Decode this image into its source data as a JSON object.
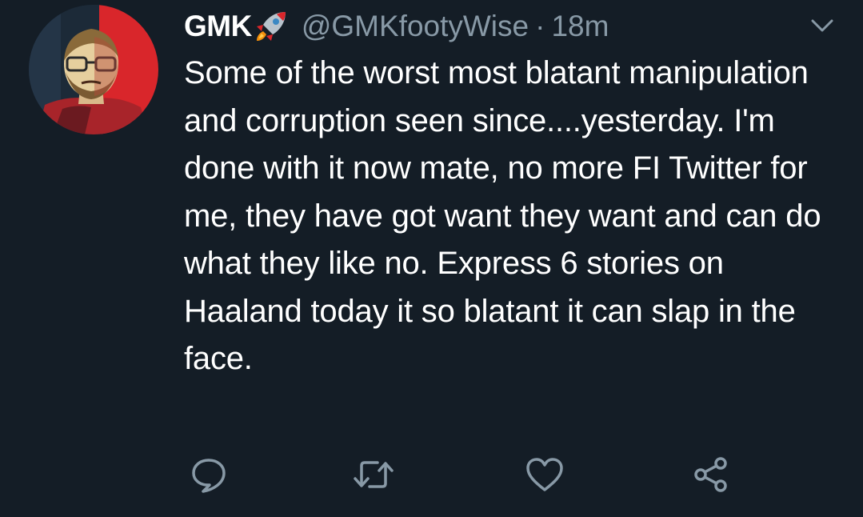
{
  "tweet": {
    "display_name": "GMK",
    "name_emoji_icon": "rocket-icon",
    "handle": "@GMKfootyWise",
    "separator": "·",
    "time": "18m",
    "text": "Some of the worst most blatant manipulation and corruption seen since....yesterday. I'm done with it now mate, no more FI Twitter for me, they have got want they want and can do what they like no. Express 6 stories on Haaland today it so blatant it can slap in the face."
  },
  "actions": [
    {
      "icon": "reply-icon"
    },
    {
      "icon": "retweet-icon"
    },
    {
      "icon": "like-heart-icon"
    },
    {
      "icon": "share-icon"
    }
  ],
  "colors": {
    "background": "#141d26",
    "text": "#ffffff",
    "secondary": "#8899a6",
    "avatar_red": "#d9262b"
  }
}
